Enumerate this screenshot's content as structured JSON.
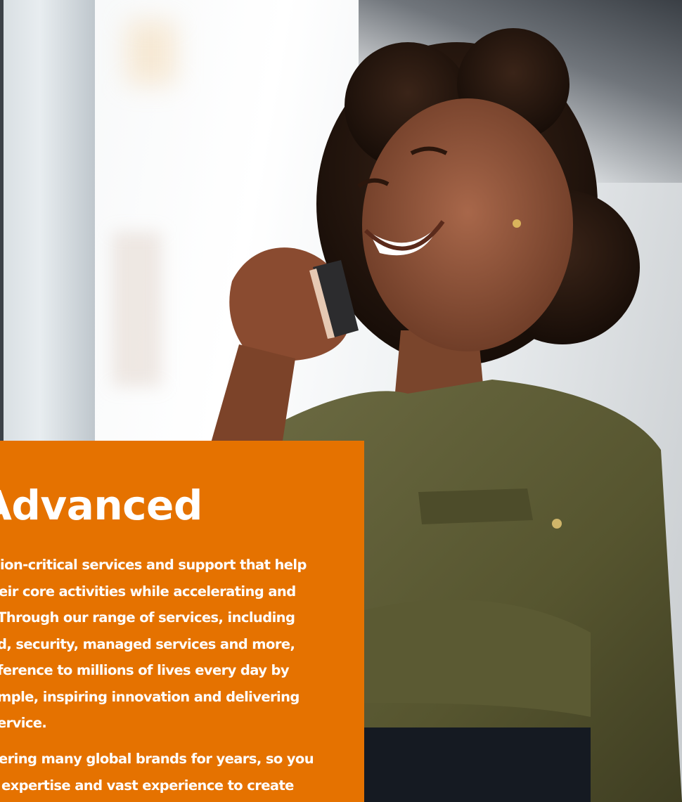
{
  "hero": {
    "image": "smiling woman talking on mobile phone near window"
  },
  "promo": {
    "title": "Advanced",
    "paragraph_1_lines": [
      "ion-critical services and support that help",
      "eir core activities while accelerating and",
      "Through our range of services, including",
      "d, security, managed services and more,",
      "ference to millions of lives every day by",
      "mple, inspiring innovation and delivering",
      "ervice."
    ],
    "paragraph_2_lines": [
      "ering many global brands for years, so you",
      "expertise and vast experience to create"
    ]
  },
  "colors": {
    "accent": "#e57200",
    "text_on_accent": "#ffffff"
  }
}
